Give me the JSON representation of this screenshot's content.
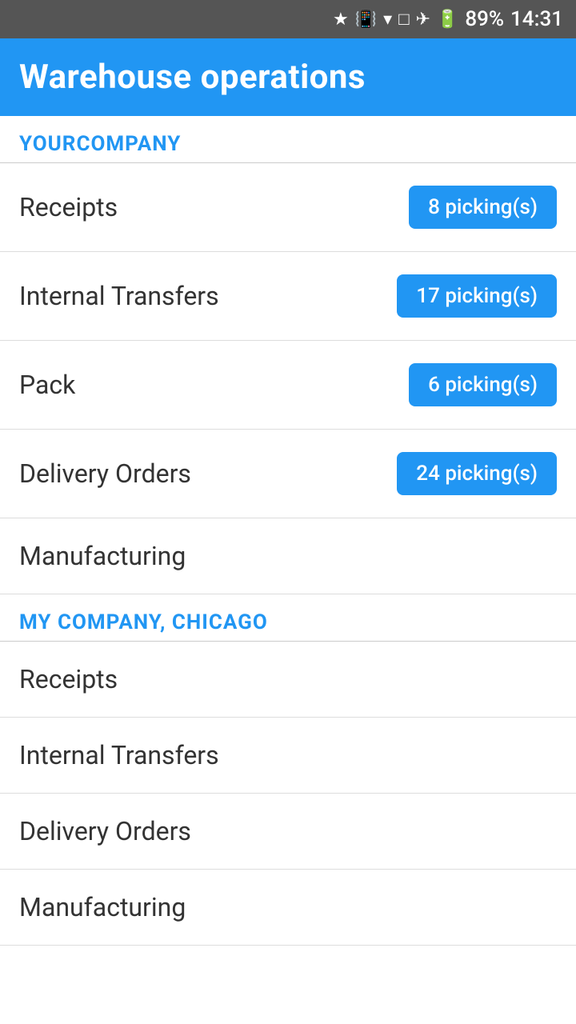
{
  "statusBar": {
    "battery": "89%",
    "time": "14:31",
    "icons": [
      "bluetooth",
      "vibrate",
      "wifi",
      "sim",
      "airplane",
      "battery"
    ]
  },
  "header": {
    "title": "Warehouse operations"
  },
  "companies": [
    {
      "name": "YOURCOMPANY",
      "operations": [
        {
          "label": "Receipts",
          "badge": "8 picking(s)",
          "hasBadge": true
        },
        {
          "label": "Internal Transfers",
          "badge": "17 picking(s)",
          "hasBadge": true
        },
        {
          "label": "Pack",
          "badge": "6 picking(s)",
          "hasBadge": true
        },
        {
          "label": "Delivery Orders",
          "badge": "24 picking(s)",
          "hasBadge": true
        },
        {
          "label": "Manufacturing",
          "badge": "",
          "hasBadge": false
        }
      ]
    },
    {
      "name": "MY COMPANY, CHICAGO",
      "operations": [
        {
          "label": "Receipts",
          "badge": "",
          "hasBadge": false
        },
        {
          "label": "Internal Transfers",
          "badge": "",
          "hasBadge": false
        },
        {
          "label": "Delivery Orders",
          "badge": "",
          "hasBadge": false
        },
        {
          "label": "Manufacturing",
          "badge": "",
          "hasBadge": false
        }
      ]
    }
  ]
}
